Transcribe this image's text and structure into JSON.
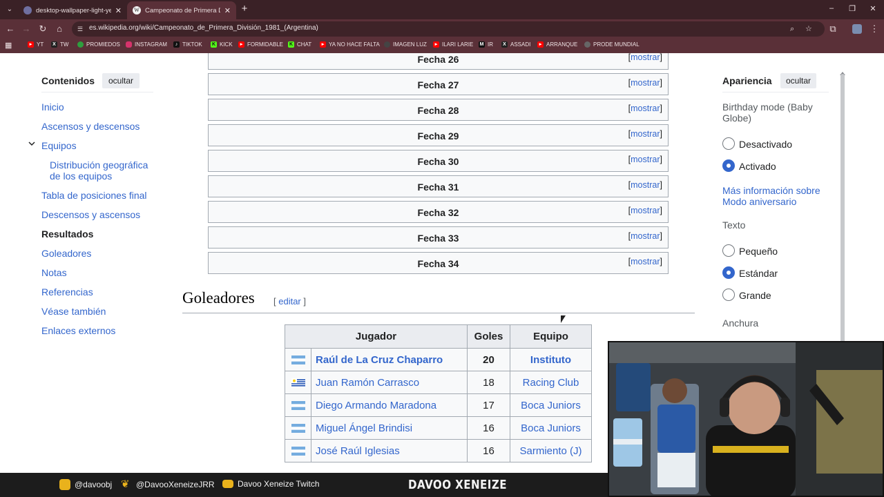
{
  "browser": {
    "tabs": [
      {
        "title": "desktop-wallpaper-light-yellow",
        "favicon_color": "#6f6fa0",
        "active": false
      },
      {
        "title": "Campeonato de Primera Divisió",
        "favicon_glyph": "W",
        "active": true
      }
    ],
    "url": "es.wikipedia.org/wiki/Campeonato_de_Primera_División_1981_(Argentina)",
    "bookmarks": [
      {
        "label": "YT",
        "color": "#ff0000"
      },
      {
        "label": "TW",
        "color": "#222222"
      },
      {
        "label": "PROMIEDOS",
        "color": "#2e9e3e"
      },
      {
        "label": "INSTAGRAM",
        "color": "#d6336c"
      },
      {
        "label": "TIKTOK",
        "color": "#111111"
      },
      {
        "label": "KICK",
        "color": "#53fc18"
      },
      {
        "label": "FORMIDABLE",
        "color": "#ff0000"
      },
      {
        "label": "CHAT",
        "color": "#53fc18"
      },
      {
        "label": "YA NO HACE FALTA",
        "color": "#ff0000"
      },
      {
        "label": "IMAGEN LUZ",
        "color": "#444444"
      },
      {
        "label": "ILARI LARIE",
        "color": "#ff0000"
      },
      {
        "label": "IR",
        "color": "#111111"
      },
      {
        "label": "ASSADI",
        "color": "#222222"
      },
      {
        "label": "ARRANQUE",
        "color": "#ff0000"
      },
      {
        "label": "PRODE MUNDIAL",
        "color": "#666666"
      }
    ]
  },
  "toc": {
    "title": "Contenidos",
    "hide_label": "ocultar",
    "items": [
      {
        "label": "Inicio"
      },
      {
        "label": "Ascensos y descensos"
      },
      {
        "label": "Equipos"
      },
      {
        "label": "Distribución geográfica de los equipos"
      },
      {
        "label": "Tabla de posiciones final"
      },
      {
        "label": "Descensos y ascensos"
      },
      {
        "label": "Resultados"
      },
      {
        "label": "Goleadores"
      },
      {
        "label": "Notas"
      },
      {
        "label": "Referencias"
      },
      {
        "label": "Véase también"
      },
      {
        "label": "Enlaces externos"
      }
    ]
  },
  "fechas": {
    "show_label": "mostrar",
    "items": [
      "Fecha 26",
      "Fecha 27",
      "Fecha 28",
      "Fecha 29",
      "Fecha 30",
      "Fecha 31",
      "Fecha 32",
      "Fecha 33",
      "Fecha 34"
    ]
  },
  "goleadores": {
    "heading": "Goleadores",
    "edit_label": "editar",
    "columns": [
      "Jugador",
      "Goles",
      "Equipo"
    ],
    "rows": [
      {
        "flag": "argentina-flag",
        "player": "Raúl de La Cruz Chaparro",
        "goals": "20",
        "team": "Instituto"
      },
      {
        "flag": "uruguay-flag",
        "player": "Juan Ramón Carrasco",
        "goals": "18",
        "team": "Racing Club"
      },
      {
        "flag": "argentina-flag",
        "player": "Diego Armando Maradona",
        "goals": "17",
        "team": "Boca Juniors"
      },
      {
        "flag": "argentina-flag",
        "player": "Miguel Ángel Brindisi",
        "goals": "16",
        "team": "Boca Juniors"
      },
      {
        "flag": "argentina-flag",
        "player": "José Raúl Iglesias",
        "goals": "16",
        "team": "Sarmiento (J)"
      }
    ]
  },
  "appearance": {
    "title": "Apariencia",
    "hide_label": "ocultar",
    "birthday_label": "Birthday mode (Baby Globe)",
    "birthday_options": [
      {
        "label": "Desactivado",
        "selected": false
      },
      {
        "label": "Activado",
        "selected": true
      }
    ],
    "more_info_link": "Más información sobre Modo aniversario",
    "text_label": "Texto",
    "text_options": [
      {
        "label": "Pequeño",
        "selected": false
      },
      {
        "label": "Estándar",
        "selected": true
      },
      {
        "label": "Grande",
        "selected": false
      }
    ],
    "width_label": "Anchura"
  },
  "stream_footer": {
    "instagram": "@davoobj",
    "twitter": "@DavooXeneizeJRR",
    "twitch": "Davoo Xeneize Twitch",
    "brand": "DAVOO XENEIZE"
  }
}
